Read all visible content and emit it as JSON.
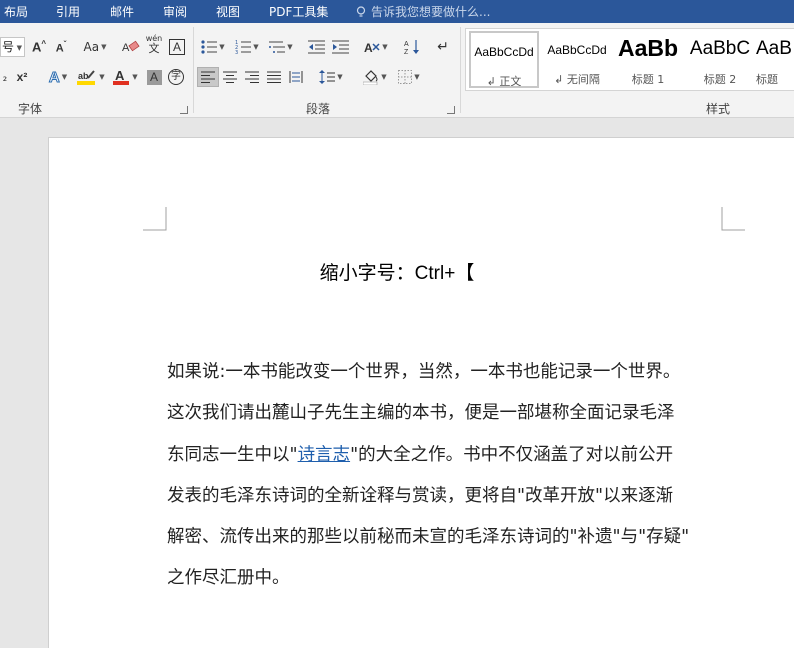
{
  "menubar": {
    "tabs": [
      "布局",
      "引用",
      "邮件",
      "审阅",
      "视图",
      "PDF工具集"
    ],
    "tell_me": "告诉我您想要做什么..."
  },
  "ribbon": {
    "font_size_value": "号",
    "group_font": "字体",
    "group_paragraph": "段落",
    "group_styles": "样式",
    "change_case": "Aa",
    "phonetic": "wén",
    "styles": [
      {
        "preview": "AaBbCcDd",
        "name": "↲ 正文"
      },
      {
        "preview": "AaBbCcDd",
        "name": "↲ 无间隔"
      },
      {
        "preview": "AaBb",
        "name": "标题 1"
      },
      {
        "preview": "AaBbC",
        "name": "标题 2"
      },
      {
        "preview": "AaB",
        "name": "标题"
      }
    ]
  },
  "colors": {
    "accent": "#2b579a",
    "highlight_yellow": "#ffd800",
    "font_red": "#e03020",
    "link": "#1f5fad"
  },
  "document": {
    "title": "缩小字号：Ctrl+【",
    "lines": [
      {
        "text": "如果说:一本书能改变一个世界，当然，一本书也能记录一个世界。"
      },
      {
        "text": "这次我们请出麓山子先生主编的本书，便是一部堪称全面记录毛泽"
      },
      {
        "pre": "东同志一生中以\"",
        "link": "诗言志",
        "post": "\"的大全之作。书中不仅涵盖了对以前公开"
      },
      {
        "text": "发表的毛泽东诗词的全新诠释与赏读，更将自\"改革开放\"以来逐渐"
      },
      {
        "text": "解密、流传出来的那些以前秘而未宣的毛泽东诗词的\"补遗\"与\"存疑\""
      },
      {
        "text": "之作尽汇册中。"
      }
    ]
  }
}
